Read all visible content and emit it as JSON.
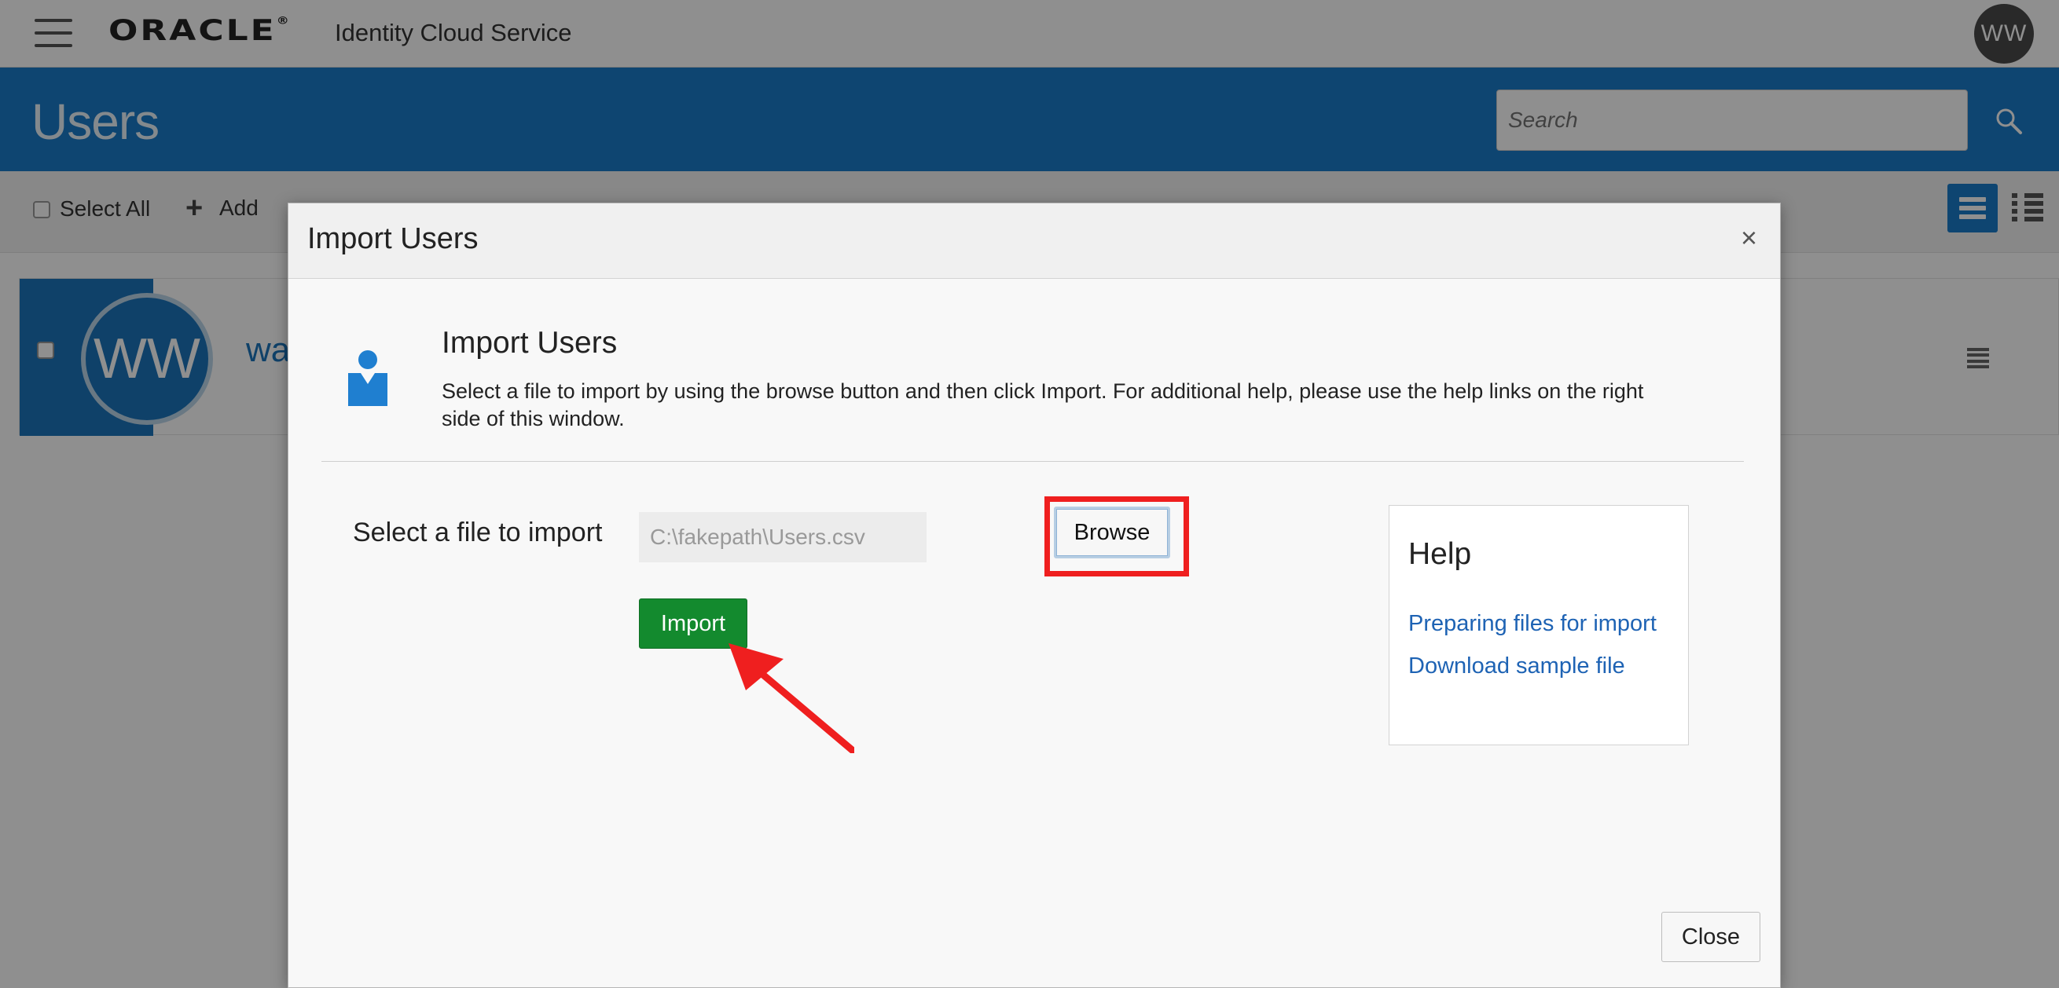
{
  "header": {
    "brand": "ORACLE",
    "brand_mark": "®",
    "service_name": "Identity Cloud Service",
    "user_initials": "WW"
  },
  "banner": {
    "page_title": "Users",
    "search_placeholder": "Search"
  },
  "toolbar": {
    "select_all_label": "Select All",
    "add_label": "Add"
  },
  "user_card": {
    "initials": "WW",
    "name_visible": "wa"
  },
  "modal": {
    "title": "Import Users",
    "close_symbol": "×",
    "intro_title": "Import Users",
    "intro_text": "Select a file to import by using the browse button and then click Import. For additional help, please use the help links on the right side of this window.",
    "file_label": "Select a file to import",
    "file_value": "C:\\fakepath\\Users.csv",
    "browse_label": "Browse",
    "import_label": "Import",
    "help": {
      "title": "Help",
      "links": [
        "Preparing files for import",
        "Download sample file"
      ]
    },
    "close_label": "Close"
  },
  "colors": {
    "banner_blue": "#1a7bc9",
    "import_green": "#138a2e",
    "link_blue": "#1e63b4",
    "annotation_red": "#ef1f1f"
  },
  "icons": [
    "hamburger-icon",
    "search-icon",
    "plus-icon",
    "list-view-icon",
    "detail-view-icon",
    "row-menu-icon",
    "user-import-icon",
    "close-icon",
    "annotation-arrow-icon"
  ]
}
